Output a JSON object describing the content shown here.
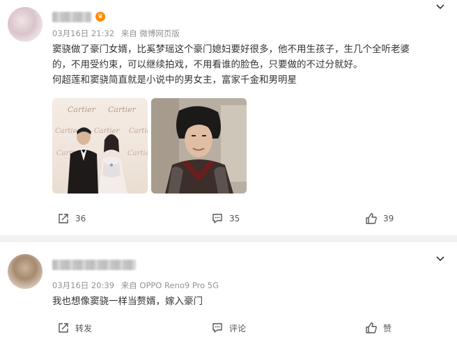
{
  "posts": [
    {
      "name": "",
      "meta": {
        "date": "03月16日 21:32",
        "source": "来自 微博网页版"
      },
      "content_lines": [
        "窦骁做了豪门女婿，比奚梦瑶这个豪门媳妇要好很多，他不用生孩子，生几个全听老婆",
        "的，不用受约束，可以继续拍戏，不用看谁的脸色，只要做的不过分就好。",
        "何超莲和窦骁简直就是小说中的男女主，富家千金和男明星"
      ],
      "images": [
        {
          "alt": "photo-couple-event",
          "watermark": "Cartier"
        },
        {
          "alt": "photo-costume-actor"
        }
      ],
      "actions": {
        "repost": "36",
        "comment": "35",
        "like": "39"
      }
    },
    {
      "name": "",
      "meta": {
        "date": "03月16日 20:39",
        "source": "来自 OPPO Reno9 Pro 5G"
      },
      "content_lines": [
        "我也想像窦骁一样当赘婿，嫁入豪门"
      ],
      "actions": {
        "repost": "转发",
        "comment": "评论",
        "like": "赞"
      }
    }
  ],
  "colors": {
    "meta_gray": "#939393",
    "text": "#333333",
    "vip_badge": "#ff8a00"
  },
  "icons": [
    "chevron-down-icon",
    "vip-badge-icon",
    "repost-icon",
    "comment-icon",
    "like-icon"
  ]
}
